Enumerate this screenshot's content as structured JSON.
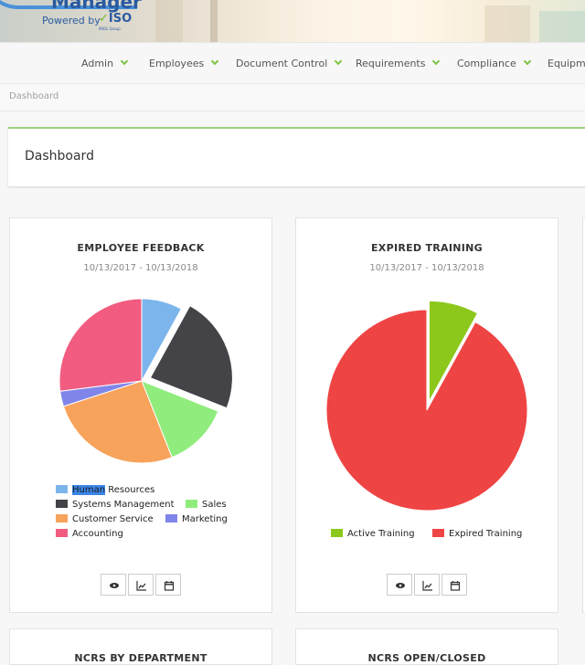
{
  "header": {
    "logo_text": "Manager",
    "powered_by": "Powered by",
    "iso_brand": "ISO",
    "iso_sub": "9001 Group"
  },
  "nav": {
    "items": [
      {
        "label": "Admin"
      },
      {
        "label": "Employees"
      },
      {
        "label": "Document Control"
      },
      {
        "label": "Requirements"
      },
      {
        "label": "Compliance"
      },
      {
        "label": "Equipme"
      }
    ],
    "accent_color": "#7cc242"
  },
  "breadcrumb": "Dashboard",
  "page_title": "Dashboard",
  "cards": [
    {
      "title": "EMPLOYEE FEEDBACK",
      "date_range": "10/13/2017 - 10/13/2018",
      "legend": [
        {
          "label_highlight": "Human",
          "label_rest": " Resources"
        },
        {
          "label": "Systems Management"
        },
        {
          "label": "Sales"
        },
        {
          "label": "Customer Service"
        },
        {
          "label": "Marketing"
        },
        {
          "label": "Accounting"
        }
      ],
      "actions": [
        "view-icon",
        "trend-chart-icon",
        "calendar-icon"
      ]
    },
    {
      "title": "EXPIRED TRAINING",
      "date_range": "10/13/2017 - 10/13/2018",
      "legend": [
        {
          "label": "Active Training"
        },
        {
          "label": "Expired Training"
        }
      ],
      "actions": [
        "view-icon",
        "trend-chart-icon",
        "calendar-icon"
      ]
    }
  ],
  "lower_cards": [
    {
      "title": "NCRS BY DEPARTMENT"
    },
    {
      "title": "NCRS OPEN/CLOSED"
    }
  ],
  "chart_data": [
    {
      "type": "pie",
      "title": "EMPLOYEE FEEDBACK",
      "subtitle": "10/13/2017 - 10/13/2018",
      "categories": [
        "Human Resources",
        "Systems Management",
        "Sales",
        "Customer Service",
        "Marketing",
        "Accounting"
      ],
      "values": [
        8,
        23,
        13,
        26,
        3,
        27
      ],
      "colors": [
        "#7cb5ec",
        "#434348",
        "#90ed7d",
        "#f7a35c",
        "#8085e9",
        "#f15c80"
      ],
      "exploded": [
        "Systems Management"
      ],
      "legend": "bottom"
    },
    {
      "type": "pie",
      "title": "EXPIRED TRAINING",
      "subtitle": "10/13/2017 - 10/13/2018",
      "categories": [
        "Active Training",
        "Expired Training"
      ],
      "values": [
        8,
        92
      ],
      "colors": [
        "#8cc81c",
        "#ef4444"
      ],
      "exploded": [
        "Active Training"
      ],
      "legend": "bottom"
    }
  ]
}
